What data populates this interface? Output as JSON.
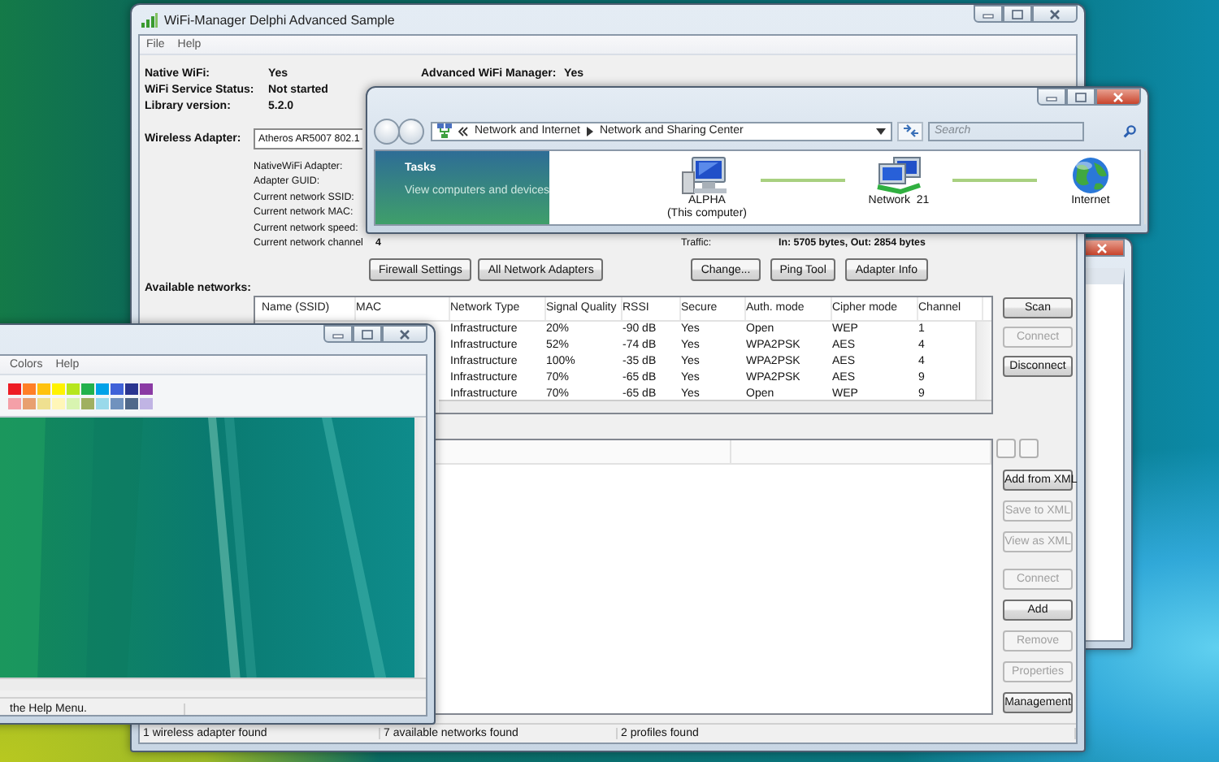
{
  "main_window": {
    "title": "WiFi-Manager Delphi Advanced Sample",
    "menu": [
      "File",
      "Help"
    ],
    "status_info": [
      {
        "label": "Native WiFi:",
        "value": "Yes"
      },
      {
        "label": "WiFi Service Status:",
        "value": "Not started"
      },
      {
        "label": "Library version:",
        "value": "5.2.0"
      }
    ],
    "advanced_info": [
      {
        "label": "Advanced WiFi Manager:",
        "value": "Yes"
      }
    ],
    "adapter": {
      "label": "Wireless Adapter:",
      "value": "Atheros AR5007 802.1"
    },
    "details": [
      {
        "label": "NativeWiFi Adapter:"
      },
      {
        "label": "Adapter GUID:"
      },
      {
        "label": "Current network SSID:"
      },
      {
        "label": "Current network MAC:"
      },
      {
        "label": "Current network speed:"
      },
      {
        "label": "Current network channel",
        "value": "4"
      }
    ],
    "traffic": {
      "label": "Traffic:",
      "value": "In: 5705 bytes, Out: 2854 bytes"
    },
    "adapter_buttons": [
      "Firewall Settings",
      "All Network Adapters"
    ],
    "traffic_buttons": [
      "Change...",
      "Ping Tool",
      "Adapter Info"
    ],
    "networks_label": "Available networks:",
    "networks": {
      "columns": [
        "Name (SSID)",
        "MAC",
        "Network Type",
        "Signal Quality",
        "RSSI",
        "Secure",
        "Auth. mode",
        "Cipher mode",
        "Channel"
      ],
      "rows": [
        {
          "cells": [
            "",
            "",
            "Infrastructure",
            "20%",
            "-90 dB",
            "Yes",
            "Open",
            "WEP",
            "1"
          ]
        },
        {
          "cells": [
            "",
            "",
            "Infrastructure",
            "52%",
            "-74 dB",
            "Yes",
            "WPA2PSK",
            "AES",
            "4"
          ]
        },
        {
          "cells": [
            "",
            "",
            "Infrastructure",
            "100%",
            "-35 dB",
            "Yes",
            "WPA2PSK",
            "AES",
            "4"
          ]
        },
        {
          "cells": [
            "",
            "",
            "Infrastructure",
            "70%",
            "-65 dB",
            "Yes",
            "WPA2PSK",
            "AES",
            "9"
          ]
        },
        {
          "cells": [
            "",
            "",
            "Infrastructure",
            "70%",
            "-65 dB",
            "Yes",
            "Open",
            "WEP",
            "9"
          ]
        }
      ]
    },
    "network_buttons": [
      {
        "label": "Scan",
        "disabled": false
      },
      {
        "label": "Connect",
        "disabled": true
      },
      {
        "label": "Disconnect",
        "disabled": false
      }
    ],
    "xml_buttons": [
      {
        "label": "Add from XML",
        "disabled": false
      },
      {
        "label": "Save to XML",
        "disabled": true
      },
      {
        "label": "View as XML",
        "disabled": true
      }
    ],
    "profile_buttons": [
      {
        "label": "Connect",
        "disabled": true
      },
      {
        "label": "Add",
        "disabled": false
      },
      {
        "label": "Remove",
        "disabled": true
      },
      {
        "label": "Properties",
        "disabled": true
      },
      {
        "label": "Management",
        "disabled": false
      }
    ],
    "status_bar": [
      "1 wireless adapter found",
      "7 available networks found",
      "2 profiles found"
    ]
  },
  "network_center": {
    "breadcrumb": [
      "Network and Internet",
      "Network and Sharing Center"
    ],
    "search": {
      "placeholder": "Search"
    },
    "tasks_title": "Tasks",
    "tasks": [
      "View computers and devices"
    ],
    "map": [
      {
        "kind": "computer",
        "label": "ALPHA",
        "sublabel": "(This computer)"
      },
      {
        "kind": "network",
        "label": "Network  21"
      },
      {
        "kind": "internet",
        "label": "Internet"
      }
    ]
  },
  "paint_window": {
    "menu": [
      "Colors",
      "Help"
    ],
    "palette": [
      {
        "color": "#ed1c24"
      },
      {
        "color": "#ff7f27"
      },
      {
        "color": "#ffc20e"
      },
      {
        "color": "#fff200"
      },
      {
        "color": "#b5e61d"
      },
      {
        "color": "#22b14c"
      },
      {
        "color": "#00a2e8"
      },
      {
        "color": "#3f62d8"
      },
      {
        "color": "#2a3590"
      },
      {
        "color": "#8a3aa4"
      },
      {
        "color": "#f4a0a8"
      },
      {
        "color": "#e8a070"
      },
      {
        "color": "#efe090"
      },
      {
        "color": "#fff6b8"
      },
      {
        "color": "#d8f4b0"
      },
      {
        "color": "#a0b060"
      },
      {
        "color": "#99d9ea"
      },
      {
        "color": "#7092be"
      },
      {
        "color": "#50688a"
      },
      {
        "color": "#c0b4e4"
      }
    ],
    "status": "the Help Menu."
  }
}
